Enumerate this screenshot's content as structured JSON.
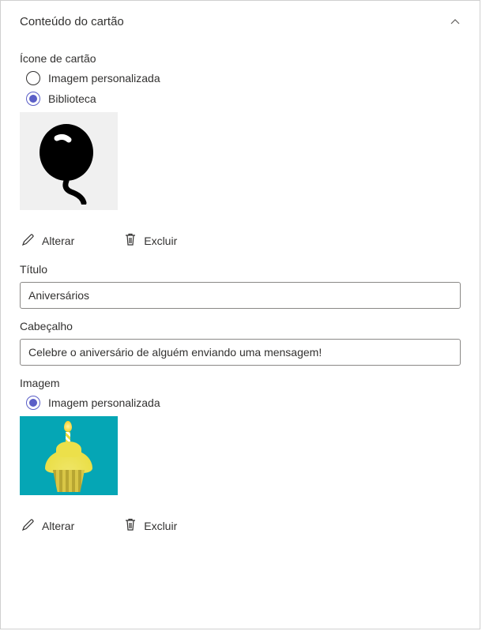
{
  "panel": {
    "title": "Conteúdo do cartão"
  },
  "iconSection": {
    "label": "Ícone de cartão",
    "option_custom": "Imagem personalizada",
    "option_library": "Biblioteca",
    "selected": "library"
  },
  "actions": {
    "change": "Alterar",
    "delete": "Excluir"
  },
  "titleField": {
    "label": "Título",
    "value": "Aniversários"
  },
  "headerField": {
    "label": "Cabeçalho",
    "value": "Celebre o aniversário de alguém enviando uma mensagem!"
  },
  "imageSection": {
    "label": "Imagem",
    "option_custom": "Imagem personalizada",
    "selected": "custom"
  }
}
